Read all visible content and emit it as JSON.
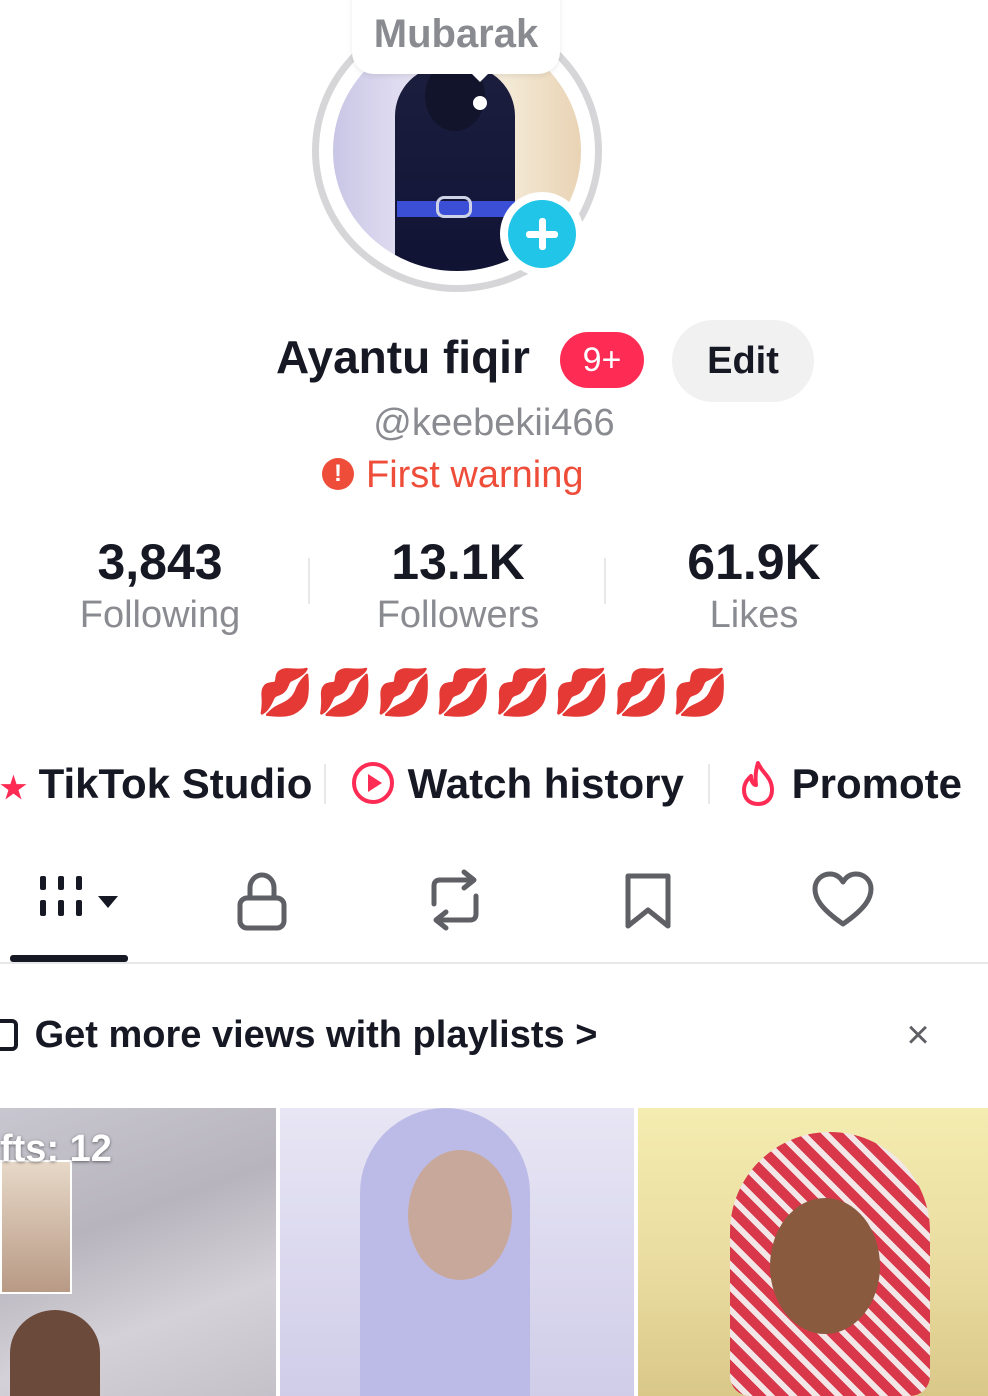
{
  "profile": {
    "status_bubble": "Mubarak",
    "name": "Ayantu fiqir",
    "badge": "9+",
    "edit_label": "Edit",
    "handle": "@keebekii466",
    "warning": "First warning",
    "bio": "💋💋💋💋💋💋💋💋"
  },
  "stats": [
    {
      "value": "3,843",
      "label": "Following"
    },
    {
      "value": "13.1K",
      "label": "Followers"
    },
    {
      "value": "61.9K",
      "label": "Likes"
    }
  ],
  "shortcuts": [
    {
      "label": "TikTok Studio",
      "icon": "star-icon"
    },
    {
      "label": "Watch history",
      "icon": "play-circle-icon"
    },
    {
      "label": "Promote",
      "icon": "flame-icon"
    }
  ],
  "tabs": [
    "videos-grid",
    "private",
    "reposts",
    "favorites",
    "liked"
  ],
  "playlist_banner": {
    "text": "Get more views with playlists",
    "chevron": ">",
    "close": "×"
  },
  "grid": {
    "drafts_label": "fts: 12"
  },
  "colors": {
    "accent": "#fe2c55",
    "warning": "#ee4d39",
    "plus": "#20c5e8"
  }
}
